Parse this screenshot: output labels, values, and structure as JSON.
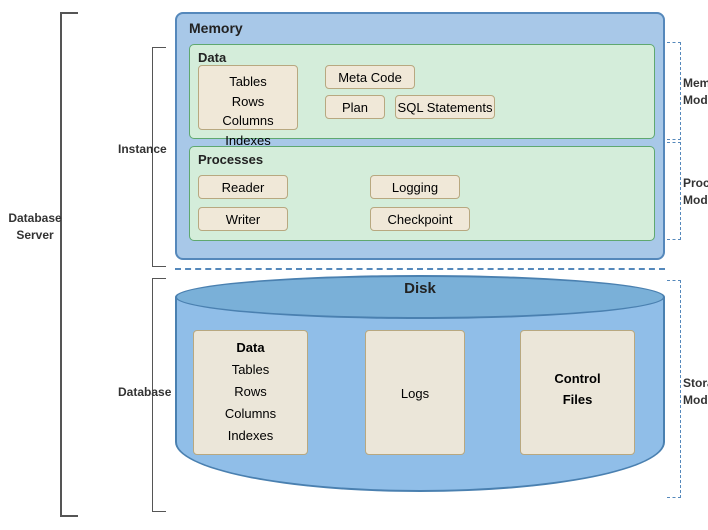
{
  "labels": {
    "memory": "Memory",
    "data": "Data",
    "tables": "Tables",
    "rows": "Rows",
    "columns": "Columns",
    "indexes": "Indexes",
    "meta_code": "Meta Code",
    "plan": "Plan",
    "sql_statements": "SQL Statements",
    "processes": "Processes",
    "reader": "Reader",
    "logging": "Logging",
    "writer": "Writer",
    "checkpoint": "Checkpoint",
    "instance": "Instance",
    "memory_model": "Memory\nModel",
    "process_model": "Process\nModel",
    "disk": "Disk",
    "data_disk": "Data",
    "tables_disk": "Tables",
    "rows_disk": "Rows",
    "columns_disk": "Columns",
    "indexes_disk": "Indexes",
    "logs": "Logs",
    "control_files": "Control\nFiles",
    "database": "Database",
    "database_server": "Database\nServer",
    "storage_model": "Storage\nModel"
  }
}
